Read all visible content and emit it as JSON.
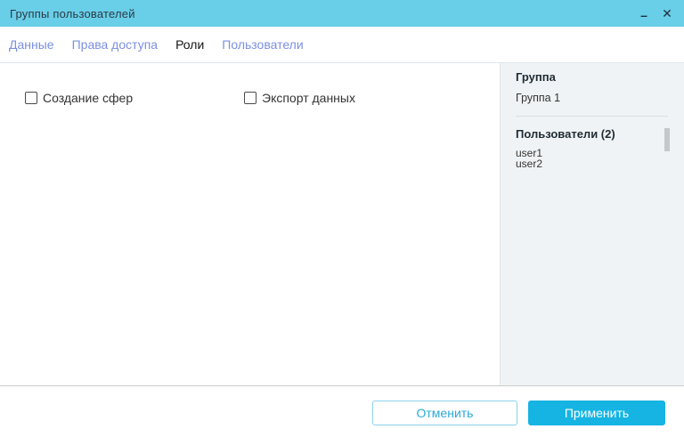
{
  "window": {
    "title": "Группы пользователей",
    "icons": {
      "minimize": "–",
      "close": "✕"
    }
  },
  "tabs": [
    {
      "label": "Данные",
      "active": false
    },
    {
      "label": "Права доступа",
      "active": false
    },
    {
      "label": "Роли",
      "active": true
    },
    {
      "label": "Пользователи",
      "active": false
    }
  ],
  "roles_tab": {
    "checkboxes": [
      {
        "label": "Создание сфер",
        "checked": false
      },
      {
        "label": "Экспорт данных",
        "checked": false
      }
    ]
  },
  "sidebar": {
    "group_header": "Группа",
    "group_name": "Группа 1",
    "users_header": "Пользователи (2)",
    "users": [
      "user1",
      "user2"
    ]
  },
  "footer": {
    "cancel_label": "Отменить",
    "apply_label": "Применить"
  },
  "colors": {
    "titlebar_bg": "#69CEE8",
    "tab_link": "#7B8FE0",
    "tab_active": "#141414",
    "accent": "#15B4E3",
    "cancel_text": "#2AA9DC",
    "panel_bg": "#F0F3F5"
  }
}
